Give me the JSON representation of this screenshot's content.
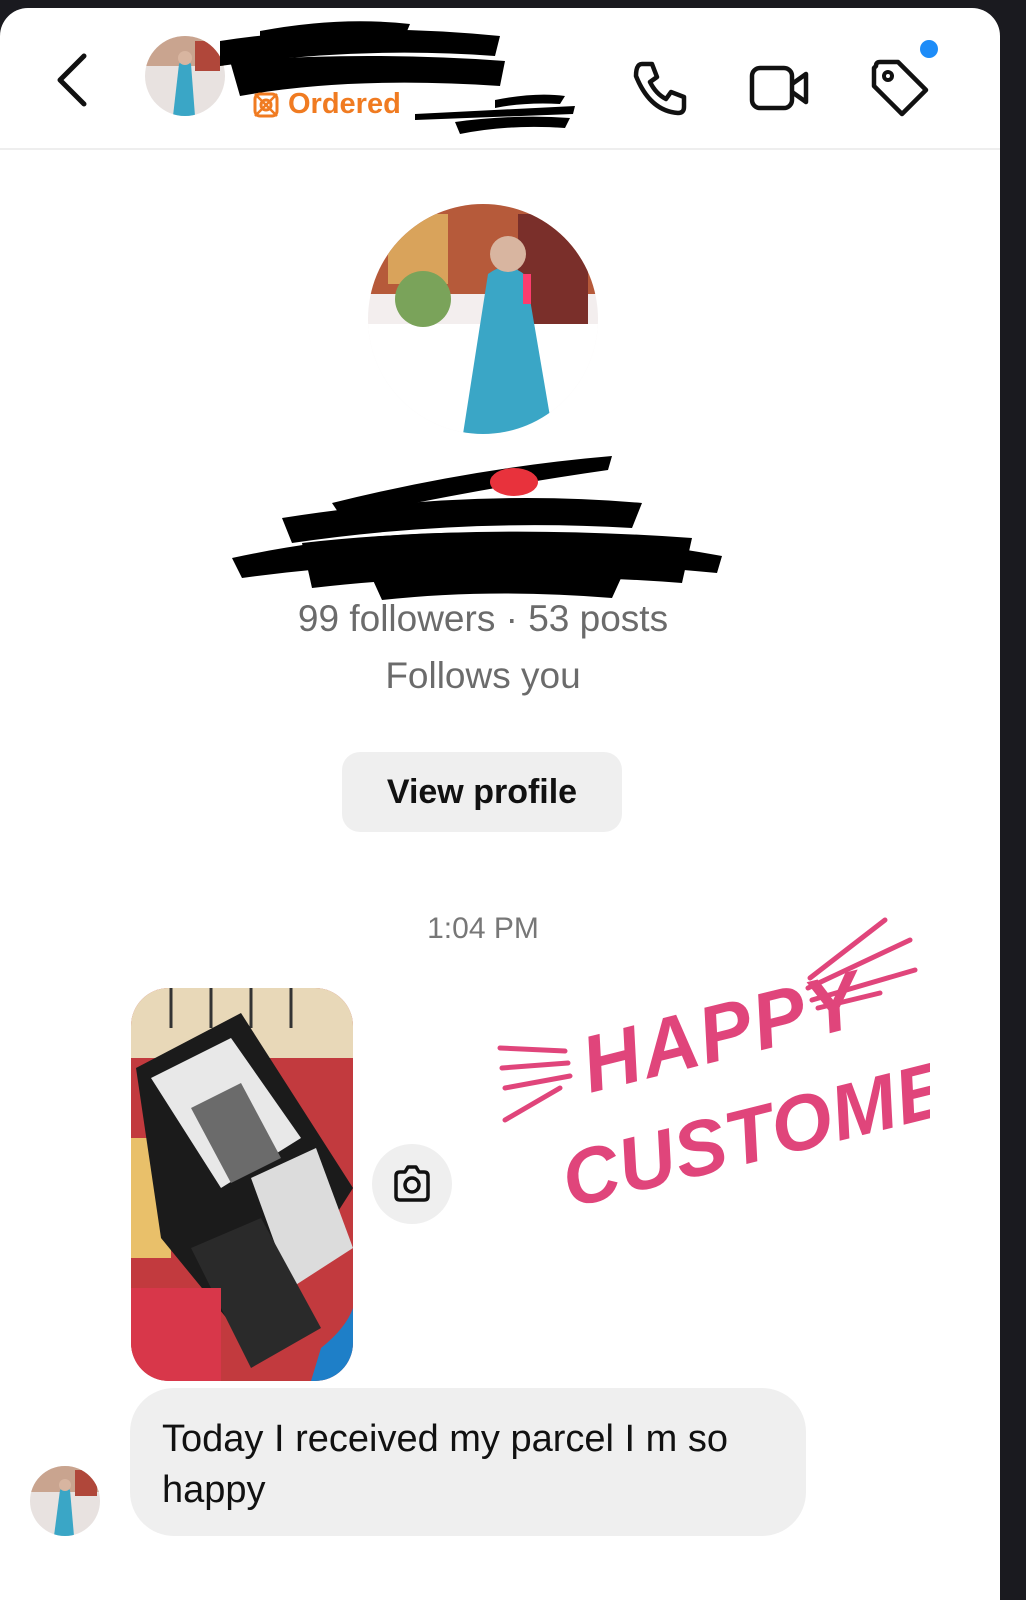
{
  "header": {
    "status_label": "Ordered",
    "icons": [
      "back-arrow-icon",
      "phone-icon",
      "video-camera-icon",
      "tag-icon"
    ],
    "accent_color": "#f07b21",
    "notification_dot_color": "#1d8cf8"
  },
  "profile": {
    "stats": "99 followers · 53 posts",
    "follows_status": "Follows you",
    "view_profile_label": "View profile"
  },
  "conversation": {
    "timestamp": "1:04 PM",
    "message_text": "Today I received my parcel I m so happy",
    "sticker_line1": "HAPPY",
    "sticker_line2": "CUSTOMER",
    "sticker_color": "#e0457b"
  }
}
